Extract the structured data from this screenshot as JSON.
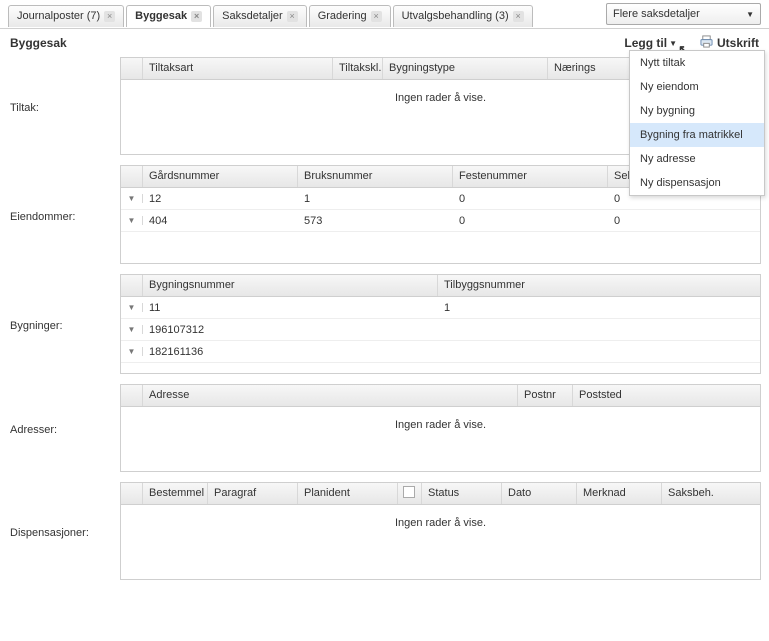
{
  "tabs": [
    {
      "label": "Journalposter (7)",
      "active": false
    },
    {
      "label": "Byggesak",
      "active": true
    },
    {
      "label": "Saksdetaljer",
      "active": false
    },
    {
      "label": "Gradering",
      "active": false
    },
    {
      "label": "Utvalgsbehandling (3)",
      "active": false
    }
  ],
  "select": {
    "label": "Flere saksdetaljer"
  },
  "page": {
    "title": "Byggesak"
  },
  "actions": {
    "leggtil": "Legg til",
    "utskrift": "Utskrift"
  },
  "dropdown": [
    {
      "label": "Nytt tiltak",
      "highlight": false
    },
    {
      "label": "Ny eiendom",
      "highlight": false
    },
    {
      "label": "Ny bygning",
      "highlight": false
    },
    {
      "label": "Bygning fra matrikkel",
      "highlight": true
    },
    {
      "label": "Ny adresse",
      "highlight": false
    },
    {
      "label": "Ny dispensasjon",
      "highlight": false
    }
  ],
  "sections": {
    "tiltak": {
      "label": "Tiltak:",
      "headers": [
        "Tiltaksart",
        "Tiltakskl.",
        "Bygningstype",
        "Nærings"
      ],
      "empty": "Ingen rader å vise."
    },
    "eiendom": {
      "label": "Eiendommer:",
      "headers": [
        "Gårdsnummer",
        "Bruksnummer",
        "Festenummer",
        "Seksjonsnummer"
      ],
      "rows": [
        {
          "cells": [
            "12",
            "1",
            "0",
            "0"
          ]
        },
        {
          "cells": [
            "404",
            "573",
            "0",
            "0"
          ]
        }
      ]
    },
    "bygning": {
      "label": "Bygninger:",
      "headers": [
        "Bygningsnummer",
        "Tilbyggsnummer"
      ],
      "rows": [
        {
          "cells": [
            "11",
            "1"
          ]
        },
        {
          "cells": [
            "196107312",
            ""
          ]
        },
        {
          "cells": [
            "182161136",
            ""
          ]
        }
      ]
    },
    "adresser": {
      "label": "Adresser:",
      "headers": [
        "Adresse",
        "Postnr",
        "Poststed"
      ],
      "empty": "Ingen rader å vise."
    },
    "disp": {
      "label": "Dispensasjoner:",
      "headers": [
        "Bestemmel",
        "Paragraf",
        "Planident",
        "",
        "Status",
        "Dato",
        "Merknad",
        "Saksbeh."
      ],
      "empty": "Ingen rader å vise."
    }
  }
}
